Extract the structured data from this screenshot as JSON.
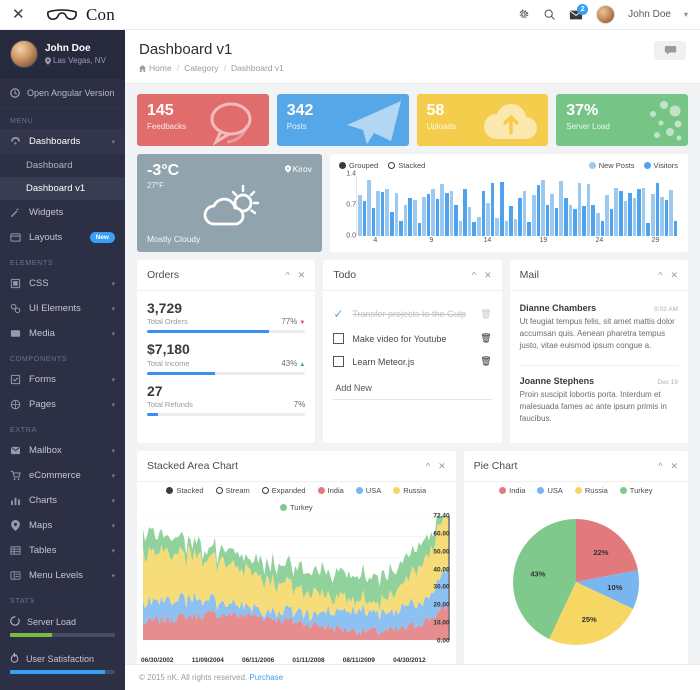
{
  "topbar": {
    "close_label": "✕",
    "brand": "Con",
    "user": "John Doe",
    "caret": "▾",
    "mail_badge": "2",
    "icons": {
      "gear": "gear-icon",
      "search": "search-icon",
      "mail": "mail-icon"
    }
  },
  "sidebar": {
    "profile": {
      "name": "John Doe",
      "location": "Las Vegas, NV"
    },
    "open_angular": "Open Angular Version",
    "sections": [
      {
        "label": "MENU",
        "items": [
          {
            "label": "Dashboards",
            "icon": "dashboard-icon",
            "expandable": true,
            "open": true,
            "children": [
              {
                "label": "Dashboard",
                "active": false
              },
              {
                "label": "Dashboard v1",
                "active": true
              }
            ]
          },
          {
            "label": "Widgets",
            "icon": "magic-icon",
            "expandable": false
          },
          {
            "label": "Layouts",
            "icon": "layout-icon",
            "expandable": false,
            "badge": "New"
          }
        ]
      },
      {
        "label": "ELEMENTS",
        "items": [
          {
            "label": "CSS",
            "icon": "css-icon",
            "expandable": true
          },
          {
            "label": "UI Elements",
            "icon": "ui-icon",
            "expandable": true
          },
          {
            "label": "Media",
            "icon": "media-icon",
            "expandable": true
          }
        ]
      },
      {
        "label": "COMPONENTS",
        "items": [
          {
            "label": "Forms",
            "icon": "form-icon",
            "expandable": true
          },
          {
            "label": "Pages",
            "icon": "pages-icon",
            "expandable": true
          }
        ]
      },
      {
        "label": "EXTRA",
        "items": [
          {
            "label": "Mailbox",
            "icon": "mailbox-icon",
            "expandable": true
          },
          {
            "label": "eCommerce",
            "icon": "cart-icon",
            "expandable": true
          },
          {
            "label": "Charts",
            "icon": "chart-icon",
            "expandable": true
          },
          {
            "label": "Maps",
            "icon": "map-pin-icon",
            "expandable": true
          },
          {
            "label": "Tables",
            "icon": "table-icon",
            "expandable": true
          },
          {
            "label": "Menu Levels",
            "icon": "menu-icon",
            "expandable": true
          }
        ]
      }
    ],
    "stats_label": "STATS",
    "stats": [
      {
        "label": "Server Load",
        "icon": "spinner-icon",
        "percent": 40,
        "color": "#79bd3f"
      },
      {
        "label": "User Satisfaction",
        "icon": "fire-icon",
        "percent": 90,
        "color": "#38a1f7"
      }
    ]
  },
  "page": {
    "title": "Dashboard v1",
    "breadcrumb": [
      "Home",
      "Category",
      "Dashboard v1"
    ],
    "breadcrumb_sep": "/",
    "chat_button": "chat-icon"
  },
  "stat_cards": [
    {
      "number": "145",
      "label": "Feedbacks",
      "color": "#e06c6c",
      "art": "bubble-icon"
    },
    {
      "number": "342",
      "label": "Posts",
      "color": "#56a7e8",
      "art": "plane-icon"
    },
    {
      "number": "58",
      "label": "Uploads",
      "color": "#f5cd4c",
      "art": "cloud-upload-icon"
    },
    {
      "number": "37%",
      "label": "Server Load",
      "color": "#76c486",
      "art": "dots-icon"
    }
  ],
  "weather": {
    "temp": "-3°C",
    "fahrenheit": "27°F",
    "city": "Kirov",
    "description": "Mostly Cloudy",
    "icon": "partly-cloudy-icon",
    "bg": "#91a4ad"
  },
  "chart_data": [
    {
      "type": "bar",
      "title": "",
      "id": "posts-visitors-bar",
      "modes": [
        {
          "label": "Grouped",
          "selected": true
        },
        {
          "label": "Stacked",
          "selected": false
        }
      ],
      "legend": [
        {
          "name": "New Posts",
          "color": "#9cc9f0"
        },
        {
          "name": "Visitors",
          "color": "#4ea3ec"
        }
      ],
      "legend_position": "top-right",
      "ylabel": "",
      "xlabel": "",
      "ylim": [
        0.0,
        1.4
      ],
      "yticks": [
        "1.4",
        "0.7",
        "0.0"
      ],
      "xticks": [
        "4",
        "9",
        "14",
        "19",
        "24",
        "29"
      ],
      "values": [
        0.95,
        0.82,
        1.3,
        0.66,
        1.04,
        1.02,
        1.1,
        0.55,
        1.0,
        0.34,
        0.72,
        0.88,
        0.84,
        0.3,
        0.92,
        0.98,
        1.1,
        0.86,
        1.22,
        1.0,
        1.04,
        0.72,
        0.36,
        1.1,
        0.68,
        0.32,
        0.44,
        1.06,
        0.78,
        1.24,
        0.42,
        1.26,
        0.36,
        0.7,
        0.4,
        0.88,
        1.04,
        0.32,
        0.96,
        1.2,
        1.3,
        0.72,
        0.98,
        0.66,
        1.28,
        0.88,
        0.72,
        0.64,
        1.24,
        0.7,
        1.22,
        0.72,
        0.54,
        0.34,
        0.96,
        0.62,
        1.12,
        1.06,
        0.82,
        1.0,
        0.88,
        1.1,
        1.12,
        0.3,
        0.98,
        1.24,
        0.9,
        0.84,
        1.08,
        0.36
      ],
      "grid": false
    },
    {
      "type": "area",
      "title": "Stacked Area Chart",
      "id": "stacked-area",
      "modes": [
        {
          "label": "Stacked",
          "selected": true
        },
        {
          "label": "Stream",
          "selected": false
        },
        {
          "label": "Expanded",
          "selected": false
        }
      ],
      "series": [
        {
          "name": "India",
          "color": "#e2797d"
        },
        {
          "name": "USA",
          "color": "#79b6ef"
        },
        {
          "name": "Russia",
          "color": "#f6d763"
        },
        {
          "name": "Turkey",
          "color": "#7ec98b"
        }
      ],
      "legend_position": "top-center",
      "ylim": [
        0.0,
        72.4
      ],
      "yticks": [
        "72.40",
        "60.00",
        "50.00",
        "40.00",
        "30.00",
        "20.00",
        "10.00",
        "0.00"
      ],
      "xticks": [
        "06/30/2002",
        "11/09/2004",
        "06/11/2006",
        "01/11/2008",
        "08/11/2009",
        "04/30/2012"
      ],
      "xlabel": "",
      "ylabel": "",
      "grid": true
    },
    {
      "type": "pie",
      "title": "Pie Chart",
      "id": "country-pie",
      "labels": [
        "India",
        "USA",
        "Russia",
        "Turkey"
      ],
      "values": [
        22,
        10,
        25,
        43
      ],
      "value_labels": [
        "22%",
        "10%",
        "25%",
        "43%"
      ],
      "colors": [
        "#e2797d",
        "#79b6ef",
        "#f6d763",
        "#7ec98b"
      ],
      "legend_position": "top-center"
    }
  ],
  "orders": {
    "title": "Orders",
    "collapse_icon": "chevron-up-icon",
    "close_icon": "close-icon",
    "rows": [
      {
        "value": "3,729",
        "label": "Total Orders",
        "percent_text": "77%",
        "percent": 77,
        "trend": "down",
        "trend_color": "#e04b4b"
      },
      {
        "value": "$7,180",
        "label": "Total Income",
        "percent_text": "43%",
        "percent": 43,
        "trend": "up",
        "trend_color": "#3cae4e"
      },
      {
        "value": "27",
        "label": "Total Refunds",
        "percent_text": "7%",
        "percent": 7,
        "trend": "none",
        "trend_color": ""
      }
    ]
  },
  "todo": {
    "title": "Todo",
    "collapse_icon": "chevron-up-icon",
    "close_icon": "close-icon",
    "items": [
      {
        "text": "Transfer projects to the Gulp",
        "done": true
      },
      {
        "text": "Make video for Youtube",
        "done": false
      },
      {
        "text": "Learn Meteor.js",
        "done": false
      }
    ],
    "add_new": "Add New"
  },
  "mail": {
    "title": "Mail",
    "collapse_icon": "chevron-up-icon",
    "close_icon": "close-icon",
    "messages": [
      {
        "sender": "Dianne Chambers",
        "time": "9:02 AM",
        "body": "Ut feugiat tempus felis, sit amet mattis dolor accumsan quis. Aenean pharetra tempus justo, vitae euismod ipsum congue a."
      },
      {
        "sender": "Joanne Stephens",
        "time": "Dec 19",
        "body": "Proin suscipit lobortis porta. Interdum et malesuada fames ac ante ipsum primis in faucibus."
      }
    ]
  },
  "footer": {
    "text": "© 2015 nK. All rights reserved.",
    "link": "Purchase"
  }
}
